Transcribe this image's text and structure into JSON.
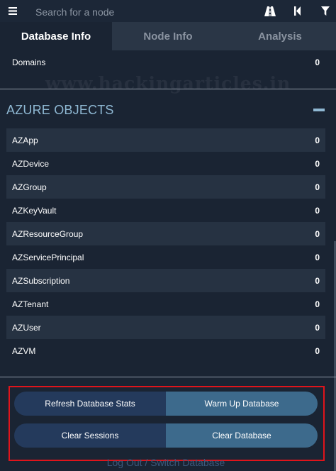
{
  "search": {
    "placeholder": "Search for a node"
  },
  "toolbar": {
    "icons": [
      "menu-icon",
      "pathfinding-road-icon",
      "back-icon",
      "filter-icon"
    ]
  },
  "tabs": [
    {
      "label": "Database Info",
      "active": true
    },
    {
      "label": "Node Info",
      "active": false
    },
    {
      "label": "Analysis",
      "active": false
    }
  ],
  "top_row": {
    "label": "Domains",
    "count": "0"
  },
  "watermark": "www.hackingarticles.in",
  "azure": {
    "title": "AZURE OBJECTS",
    "collapse_icon": "minus-icon",
    "rows": [
      {
        "label": "AZApp",
        "count": "0"
      },
      {
        "label": "AZDevice",
        "count": "0"
      },
      {
        "label": "AZGroup",
        "count": "0"
      },
      {
        "label": "AZKeyVault",
        "count": "0"
      },
      {
        "label": "AZResourceGroup",
        "count": "0"
      },
      {
        "label": "AZServicePrincipal",
        "count": "0"
      },
      {
        "label": "AZSubscription",
        "count": "0"
      },
      {
        "label": "AZTenant",
        "count": "0"
      },
      {
        "label": "AZUser",
        "count": "0"
      },
      {
        "label": "AZVM",
        "count": "0"
      }
    ]
  },
  "actions": {
    "refresh_stats": "Refresh Database Stats",
    "warm_up": "Warm Up Database",
    "clear_sessions": "Clear Sessions",
    "clear_database": "Clear Database",
    "logout": "Log Out / Switch Database"
  },
  "colors": {
    "background": "#1a2433",
    "section_accent": "#8fb8d3",
    "highlight_border": "#e0141b",
    "button_dark": "#243a5c",
    "button_light": "#3d6a8c"
  }
}
